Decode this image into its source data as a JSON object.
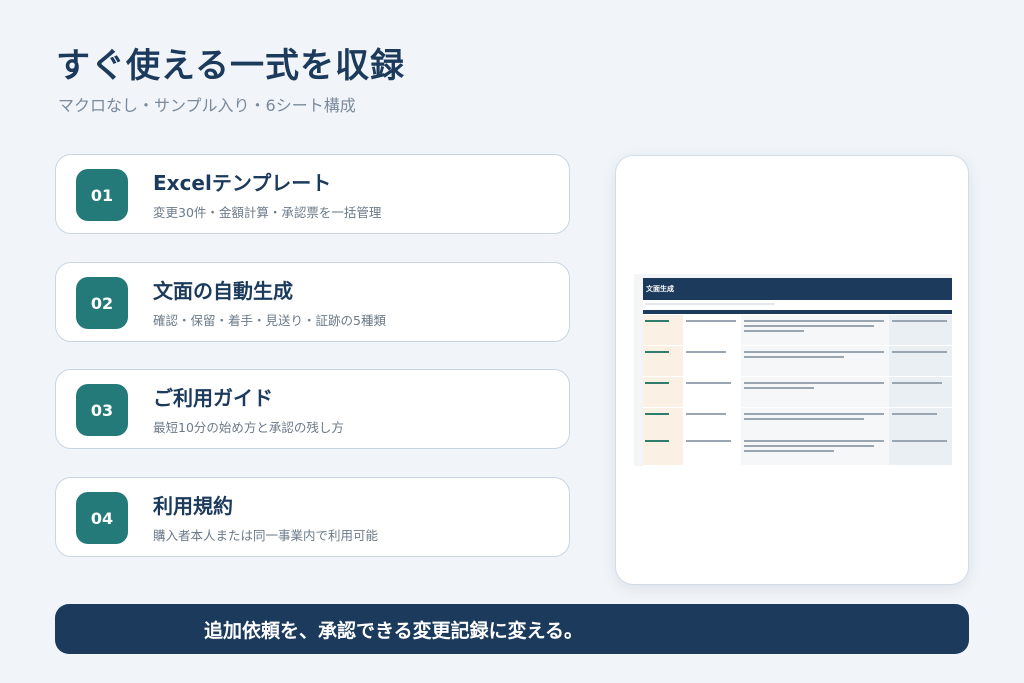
{
  "header": {
    "title": "すぐ使える一式を収録",
    "subtitle": "マクロなし・サンプル入り・6シート構成"
  },
  "items": [
    {
      "number": "01",
      "title": "Excelテンプレート",
      "description": "変更30件・金額計算・承認票を一括管理"
    },
    {
      "number": "02",
      "title": "文面の自動生成",
      "description": "確認・保留・着手・見送り・証跡の5種類"
    },
    {
      "number": "03",
      "title": "ご利用ガイド",
      "description": "最短10分の始め方と承認の残し方"
    },
    {
      "number": "04",
      "title": "利用規約",
      "description": "購入者本人または同一事業内で利用可能"
    }
  ],
  "preview": {
    "sheet_title": "文面生成"
  },
  "banner": {
    "text": "追加依頼を、承認できる変更記録に変える。"
  },
  "colors": {
    "accent": "#237a78",
    "navy": "#1b3a5c",
    "background": "#f1f5f9"
  }
}
